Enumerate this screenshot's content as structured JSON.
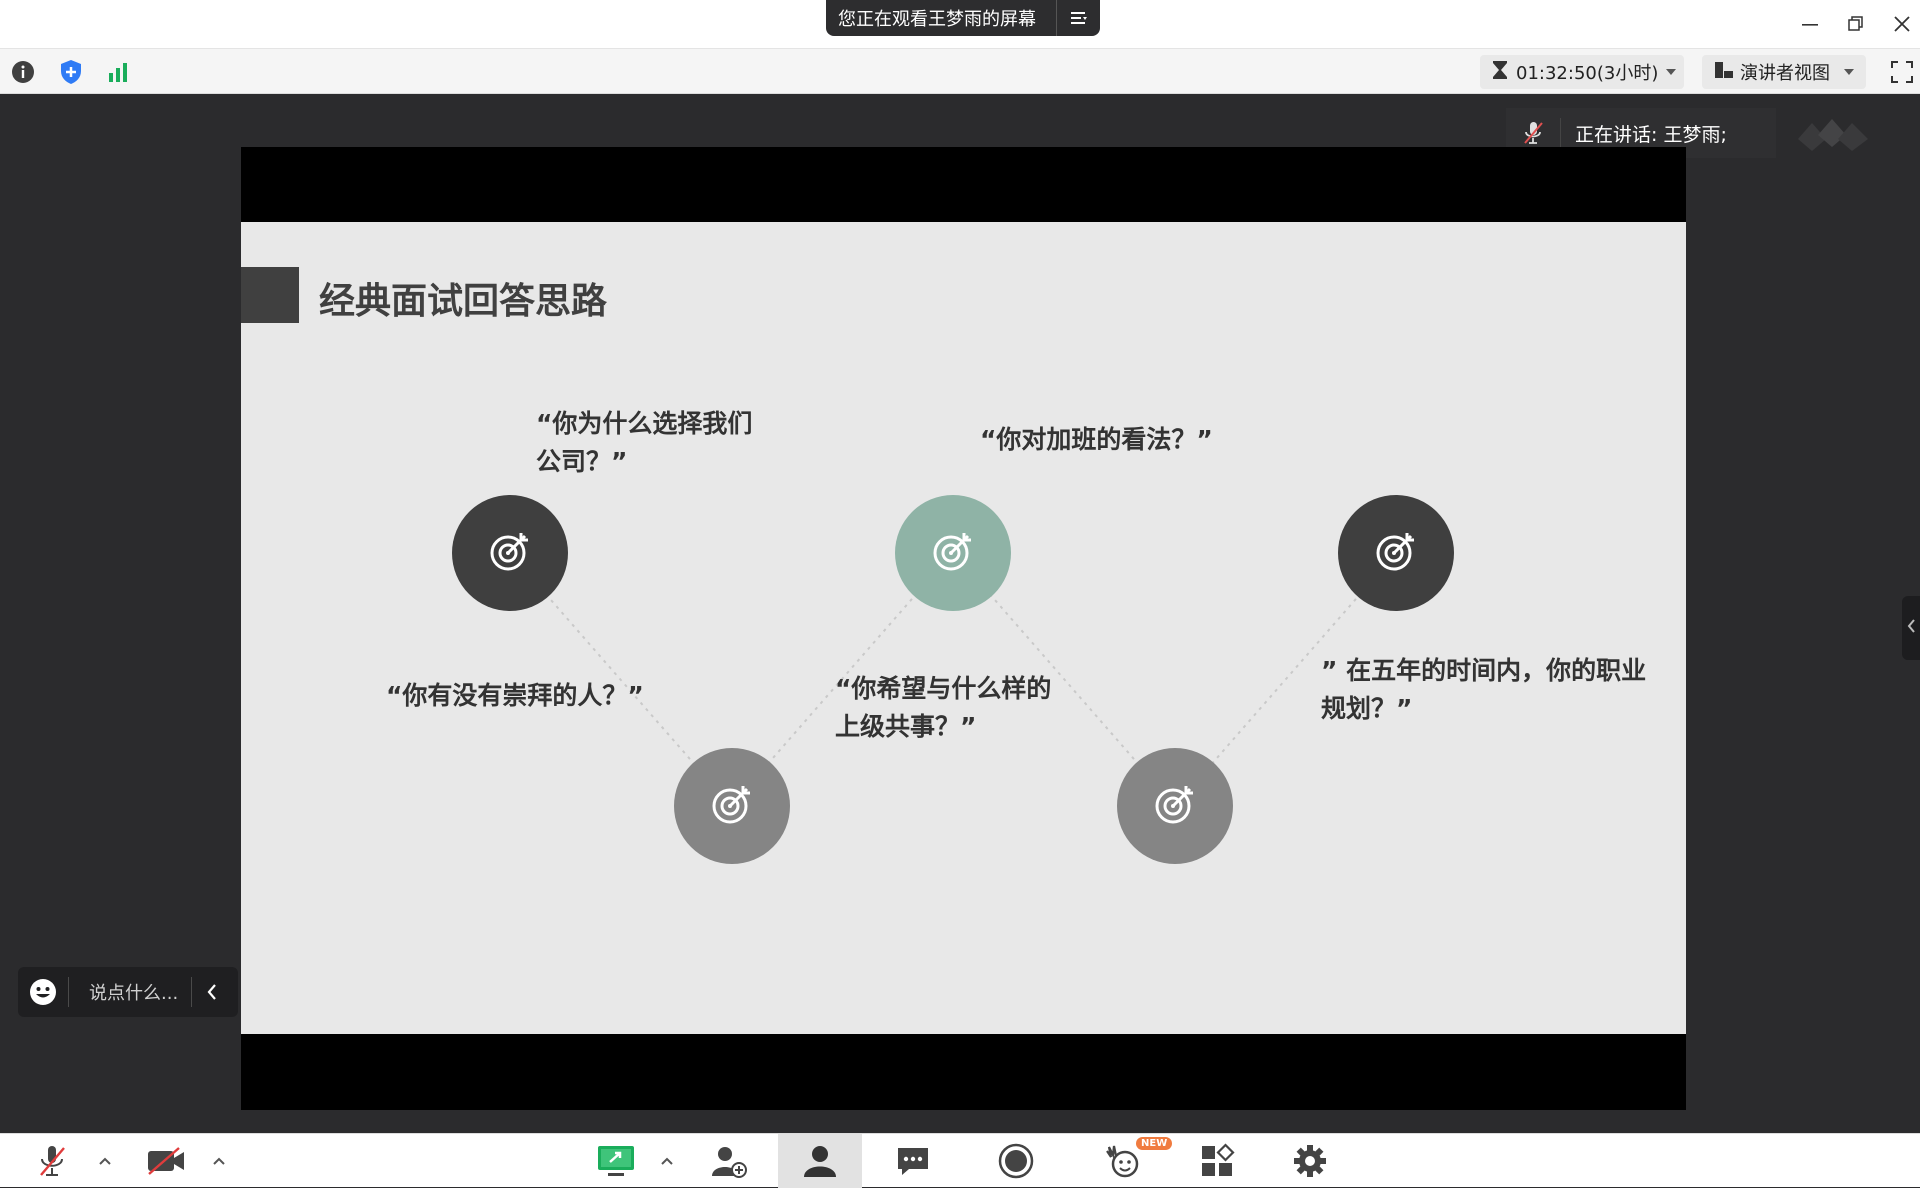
{
  "titlebar": {
    "share_notice": "您正在观看王梦雨的屏幕"
  },
  "toolbar": {
    "timer": "01:32:50(3小时)",
    "view_mode": "演讲者视图"
  },
  "speaker": {
    "label": "正在讲话: 王梦雨;"
  },
  "slide": {
    "title": "经典面试回答思路",
    "questions": [
      "“你为什么选择我们公司？”",
      "“你有没有崇拜的人？”",
      "“你对加班的看法？”",
      "“你希望与什么样的上级共事？”",
      "” 在五年的时间内，你的职业规划？”"
    ]
  },
  "chat": {
    "placeholder": "说点什么..."
  },
  "bottom": {
    "new_badge": "NEW"
  },
  "colors": {
    "node_dark": "#3f3f3f",
    "node_grey": "#858585",
    "node_teal": "#8fb3a6",
    "accent_green": "#1aad5b",
    "shield_blue": "#2f7bf5"
  }
}
